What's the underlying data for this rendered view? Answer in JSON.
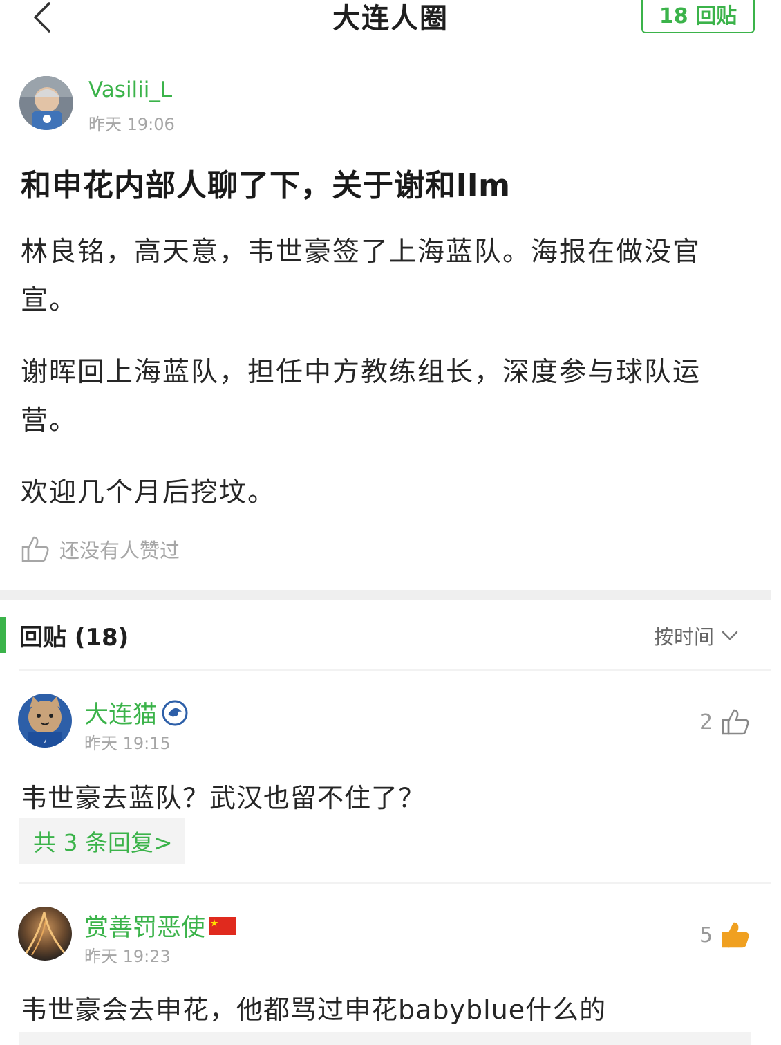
{
  "nav": {
    "title": "大连人圈",
    "reply_count_label": "18 回贴",
    "back_icon": "chevron-left-icon"
  },
  "post": {
    "author": {
      "name": "Vasilii_L",
      "time": "昨天 19:06"
    },
    "title": "和申花内部人聊了下，关于谢和llm",
    "paragraphs": [
      "林良铭，高天意，韦世豪签了上海蓝队。海报在做没官宣。",
      "谢晖回上海蓝队，担任中方教练组长，深度参与球队运营。",
      "欢迎几个月后挖坟。"
    ],
    "like_text": "还没有人赞过",
    "like_icon": "thumbs-up-icon"
  },
  "replies_section": {
    "title": "回贴 (18)",
    "sort_label": "按时间"
  },
  "replies": [
    {
      "name": "大连猫",
      "badge_icon": "team-badge-icon",
      "time": "昨天 19:15",
      "likes": "2",
      "content": "韦世豪去蓝队？武汉也留不住了？",
      "sub_replies_label": "共 3 条回复>"
    },
    {
      "name": "赏善罚恶使",
      "badge_icon": "china-flag-icon",
      "time": "昨天 19:23",
      "likes": "5",
      "content": "韦世豪会去申花，他都骂过申花babyblue什么的"
    }
  ],
  "colors": {
    "accent_green": "#3bb34a",
    "like_orange": "#f0a020",
    "muted_gray": "#a6a6a6"
  }
}
